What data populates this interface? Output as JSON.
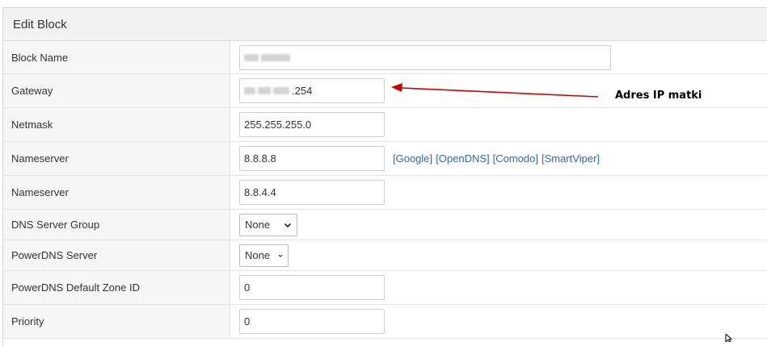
{
  "panel": {
    "title": "Edit Block"
  },
  "form": {
    "block_name": {
      "label": "Block Name",
      "value": ""
    },
    "gateway": {
      "label": "Gateway",
      "value_suffix": ".254"
    },
    "netmask": {
      "label": "Netmask",
      "value": "255.255.255.0"
    },
    "nameserver1": {
      "label": "Nameserver",
      "value": "8.8.8.8",
      "presets": [
        "[Google]",
        "[OpenDNS]",
        "[Comodo]",
        "[SmartViper]"
      ]
    },
    "nameserver2": {
      "label": "Nameserver",
      "value": "8.8.4.4"
    },
    "dns_server_group": {
      "label": "DNS Server Group",
      "selected": "None"
    },
    "powerdns_server": {
      "label": "PowerDNS Server",
      "selected": "None"
    },
    "powerdns_zone_id": {
      "label": "PowerDNS Default Zone ID",
      "value": "0"
    },
    "priority": {
      "label": "Priority",
      "value": "0"
    }
  },
  "annotation": {
    "text": "Adres IP matki",
    "color": "#d00000"
  },
  "colors": {
    "link": "#3366bb",
    "header_bg": "#f2f2f2",
    "label_bg": "#f6f6f6"
  }
}
